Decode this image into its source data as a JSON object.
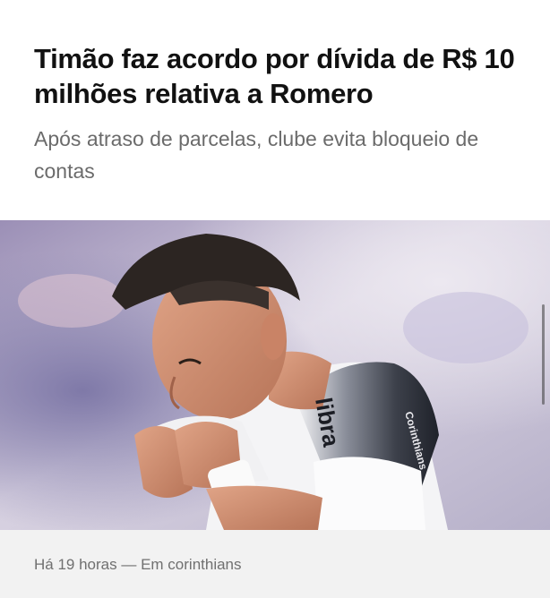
{
  "article": {
    "headline": "Timão faz acordo por dívida de R$ 10 milhões relativa a Romero",
    "subheadline": "Após atraso de parcelas, clube evita bloqueio de contas",
    "photo": {
      "kit_text": "libra",
      "sleeve_text": "Corinthians"
    },
    "meta": {
      "time_ago": "Há 19 horas",
      "separator": " — ",
      "section": "Em corinthians"
    }
  }
}
